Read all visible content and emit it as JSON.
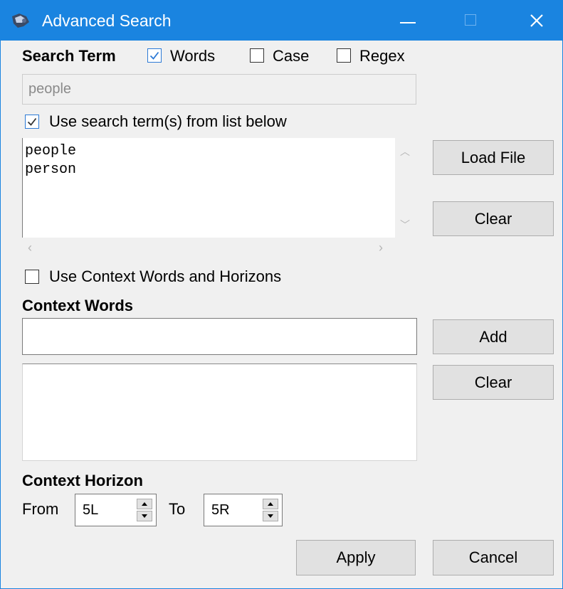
{
  "window": {
    "title": "Advanced Search",
    "accent_color": "#1a84e0"
  },
  "search_term": {
    "label": "Search Term",
    "options": [
      {
        "label": "Words",
        "checked": true
      },
      {
        "label": "Case",
        "checked": false
      },
      {
        "label": "Regex",
        "checked": false
      }
    ],
    "input_placeholder": "people",
    "input_disabled": true,
    "use_list": {
      "label": "Use search term(s) from list below",
      "checked": true
    },
    "list_text": "people\nperson",
    "load_file_label": "Load File",
    "clear_label": "Clear"
  },
  "context": {
    "use_context": {
      "label": "Use Context Words and Horizons",
      "checked": false
    },
    "words_label": "Context Words",
    "words_input_value": "",
    "add_label": "Add",
    "clear_label": "Clear",
    "horizon_label": "Context Horizon",
    "from_label": "From",
    "from_value": "5L",
    "to_label": "To",
    "to_value": "5R"
  },
  "footer": {
    "apply_label": "Apply",
    "cancel_label": "Cancel"
  }
}
